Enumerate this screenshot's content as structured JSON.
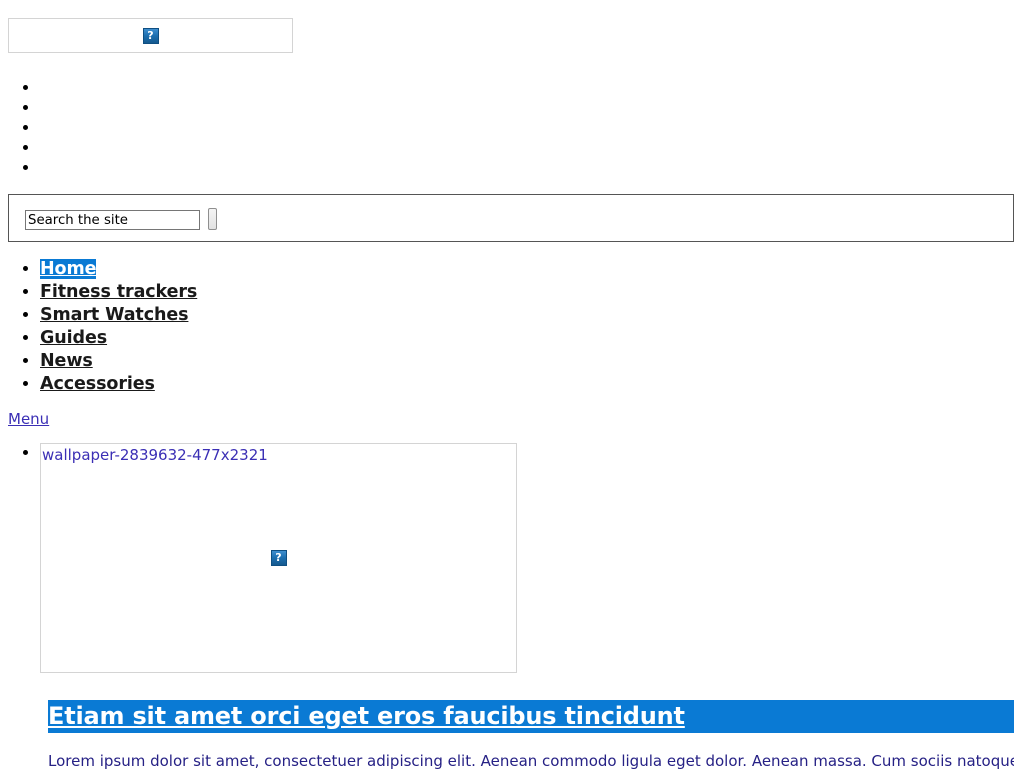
{
  "page": {
    "background": "#ffffff",
    "accent_blue": "#0a7ad4",
    "link_blue": "#3b2fb5",
    "excerpt_color": "#262185"
  },
  "banner": {
    "image_alt": "",
    "broken_icon": "broken-image-icon",
    "broken_glyph": "?"
  },
  "social": {
    "items": [
      {
        "label": ""
      },
      {
        "label": ""
      },
      {
        "label": ""
      },
      {
        "label": ""
      },
      {
        "label": ""
      }
    ]
  },
  "search": {
    "value": "Search the site",
    "placeholder": "Search the site",
    "submit_label": ""
  },
  "nav": {
    "items": [
      {
        "label": "Home",
        "selected": true
      },
      {
        "label": "Fitness trackers",
        "selected": false
      },
      {
        "label": "Smart Watches",
        "selected": false
      },
      {
        "label": "Guides",
        "selected": false
      },
      {
        "label": "News",
        "selected": false
      },
      {
        "label": "Accessories",
        "selected": false
      }
    ],
    "menu_toggle_label": "Menu"
  },
  "slider": {
    "items": [
      {
        "alt": "wallpaper-2839632-477x2321",
        "broken_glyph": "?"
      }
    ]
  },
  "post": {
    "title": "Etiam sit amet orci eget eros faucibus tincidunt",
    "excerpt": "Lorem ipsum dolor sit amet, consectetuer adipiscing elit. Aenean commodo ligula eget dolor. Aenean massa. Cum sociis natoque penatibus et"
  }
}
